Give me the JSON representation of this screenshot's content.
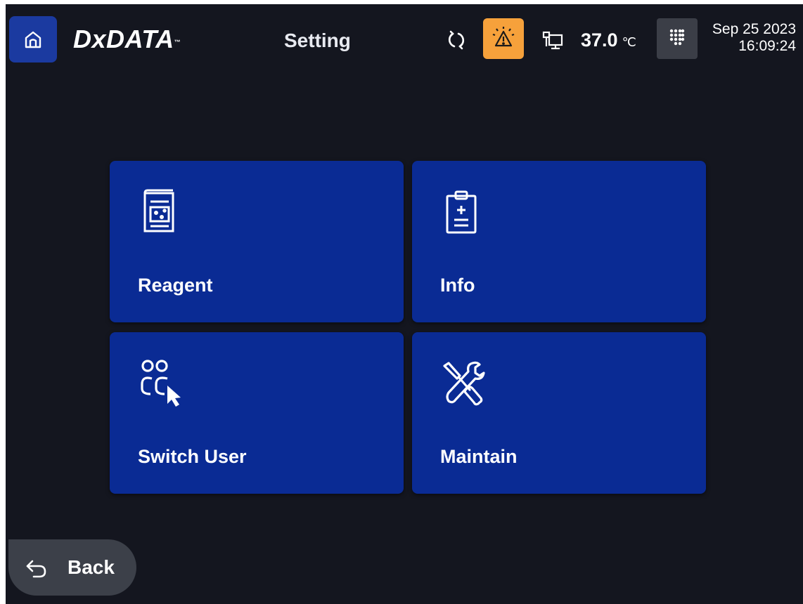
{
  "header": {
    "logo_text": "DxDATA",
    "logo_mark": "™",
    "page_title": "Setting",
    "temperature": "37.0",
    "temperature_unit": "℃",
    "date": "Sep 25 2023",
    "time": "16:09:24"
  },
  "icons": {
    "home": "home-icon",
    "sync": "sync-icon",
    "warning": "warning-icon",
    "network": "network-icon",
    "keypad": "keypad-icon",
    "reagent": "reagent-icon",
    "info": "clipboard-icon",
    "switch_user": "switch-user-icon",
    "maintain": "tools-icon",
    "back": "back-arrow-icon"
  },
  "tiles": [
    {
      "label": "Reagent"
    },
    {
      "label": "Info"
    },
    {
      "label": "Switch User"
    },
    {
      "label": "Maintain"
    }
  ],
  "footer": {
    "back_label": "Back"
  },
  "colors": {
    "background": "#14161f",
    "tile": "#0a2b94",
    "home_button": "#1b3aa0",
    "warning_button": "#f6a13b",
    "keypad_button": "#3b3e47",
    "back_button": "#3c4049"
  }
}
